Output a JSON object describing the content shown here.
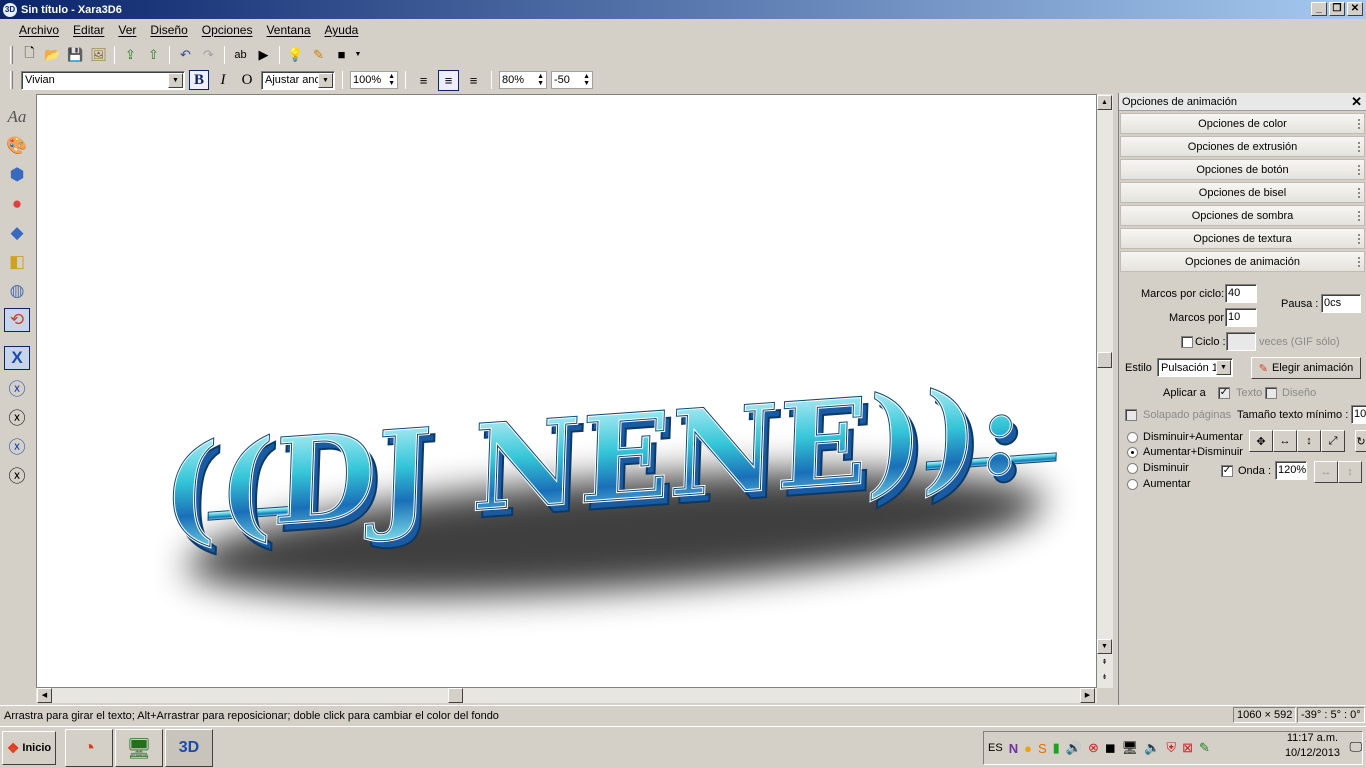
{
  "window": {
    "title": "Sin título - Xara3D6"
  },
  "menu": [
    "Archivo",
    "Editar",
    "Ver",
    "Diseño",
    "Opciones",
    "Ventana",
    "Ayuda"
  ],
  "format_bar": {
    "font": "Vivian",
    "bold": "B",
    "italic": "I",
    "outline": "O",
    "fit": "Ajustar anc",
    "size": "100%",
    "line_spacing": "80%",
    "char_spacing": "-50"
  },
  "canvas": {
    "text": "((DJ NENE)):",
    "text_color": "#2fb5c8",
    "bg": "#ffffff"
  },
  "panel": {
    "title": "Opciones de animación",
    "sections": [
      "Opciones de color",
      "Opciones de extrusión",
      "Opciones de botón",
      "Opciones de bisel",
      "Opciones de sombra",
      "Opciones de textura",
      "Opciones de animación"
    ],
    "anim": {
      "frames_label": "Marcos por ciclo:",
      "frames_value": "40",
      "fps_label": "Marcos por",
      "fps_value": "10",
      "pause_label": "Pausa :",
      "pause_value": "0cs",
      "cycle_label": "Ciclo :",
      "cycle_suffix": "veces (GIF sólo)",
      "style_label": "Estilo",
      "style_value": "Pulsación 1",
      "choose_button": "Elegir animación",
      "apply_label": "Aplicar a",
      "apply_text": "Texto",
      "apply_design": "Diseño",
      "overlap_label": "Solapado páginas",
      "min_text_label": "Tamaño texto mínimo :",
      "min_text_value": "10",
      "radio_options": [
        "Disminuir+Aumentar",
        "Aumentar+Disminuir",
        "Disminuir",
        "Aumentar"
      ],
      "selected_radio": "Aumentar+Disminuir",
      "wave_label": "Onda :",
      "wave_value": "120%"
    }
  },
  "status": {
    "message": "Arrastra para girar el texto; Alt+Arrastrar para reposicionar; doble click para cambiar el color del fondo",
    "size": "1060 × 592",
    "angles": "-39° : 5° : 0°"
  },
  "taskbar": {
    "start": "Inicio",
    "lang": "ES",
    "time": "11:17 a.m.",
    "date": "10/12/2013"
  }
}
